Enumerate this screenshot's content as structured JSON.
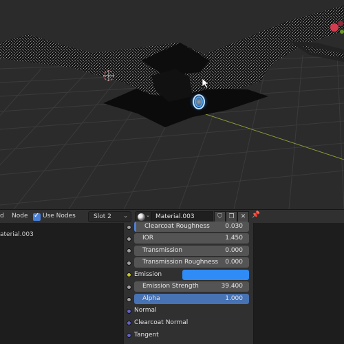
{
  "header": {
    "cut_label": "d",
    "node_menu": "Node",
    "use_nodes_label": "Use Nodes",
    "use_nodes_checked": true,
    "slot_value": "Slot 2",
    "material_name": "Material.003"
  },
  "tree": {
    "item": "aterial.003"
  },
  "node": {
    "inputs": [
      {
        "label": "Clearcoat Roughness",
        "value": "0.030"
      },
      {
        "label": "IOR",
        "value": "1.450"
      },
      {
        "label": "Transmission",
        "value": "0.000"
      },
      {
        "label": "Transmission Roughness",
        "value": "0.000"
      }
    ],
    "emission": {
      "label": "Emission",
      "color": "#2f8bf5"
    },
    "emission_strength": {
      "label": "Emission Strength",
      "value": "39.400"
    },
    "alpha": {
      "label": "Alpha",
      "value": "1.000"
    },
    "vector_inputs": [
      "Normal",
      "Clearcoat Normal",
      "Tangent"
    ]
  },
  "colors": {
    "accent": "#4772b3",
    "viewport_background": "#2b2b2b",
    "panel": "#303030",
    "emission_glow": "#4ea8ff"
  },
  "icons": [
    "checkbox-check-icon",
    "chevron-down-icon",
    "material-ball-icon",
    "fake-user-shield-icon",
    "duplicate-icon",
    "close-icon",
    "pin-icon",
    "mouse-cursor-icon",
    "3d-cursor-icon",
    "gizmo-axis-icon"
  ]
}
